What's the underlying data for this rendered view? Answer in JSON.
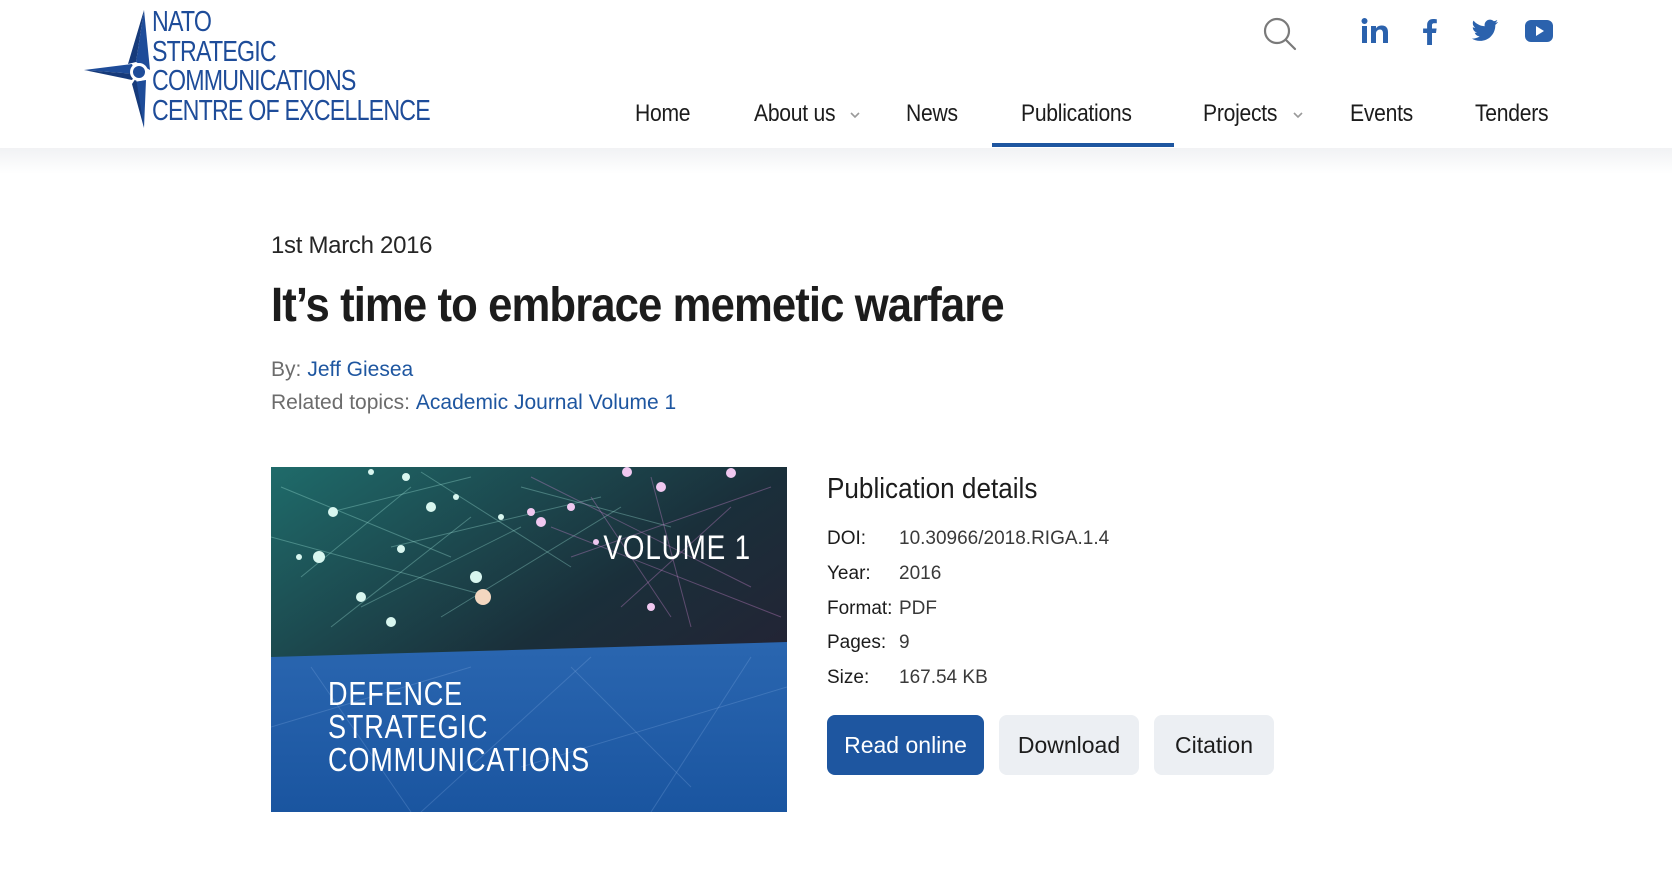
{
  "brand": {
    "logo_lines": [
      "NATO",
      "STRATEGIC",
      "COMMUNICATIONS",
      "CENTRE OF EXCELLENCE"
    ],
    "color": "#1e4c99"
  },
  "header": {
    "icons": [
      "search-icon",
      "linkedin-icon",
      "facebook-icon",
      "twitter-icon",
      "youtube-icon"
    ]
  },
  "nav": {
    "items": [
      {
        "label": "Home"
      },
      {
        "label": "About us"
      },
      {
        "label": "News"
      },
      {
        "label": "Publications"
      },
      {
        "label": "Projects"
      },
      {
        "label": "Events"
      },
      {
        "label": "Tenders"
      }
    ],
    "active": "Publications",
    "accent": "#1e56a0"
  },
  "article": {
    "date": "1st March 2016",
    "title": "It’s time to embrace memetic warfare",
    "by_label": "By:",
    "author": "Jeff Giesea",
    "topics_label": "Related topics:",
    "topic": "Academic Journal Volume 1"
  },
  "cover": {
    "volume": "VOLUME 1",
    "title_lines": [
      "DEFENCE",
      "STRATEGIC",
      "COMMUNICATIONS"
    ]
  },
  "details": {
    "heading": "Publication details",
    "rows": [
      {
        "key": "DOI:",
        "value": "10.30966/2018.RIGA.1.4"
      },
      {
        "key": "Year:",
        "value": "2016"
      },
      {
        "key": "Format:",
        "value": "PDF"
      },
      {
        "key": "Pages:",
        "value": "9"
      },
      {
        "key": "Size:",
        "value": "167.54 KB"
      }
    ]
  },
  "actions": {
    "read_online": "Read online",
    "download": "Download",
    "citation": "Citation"
  }
}
